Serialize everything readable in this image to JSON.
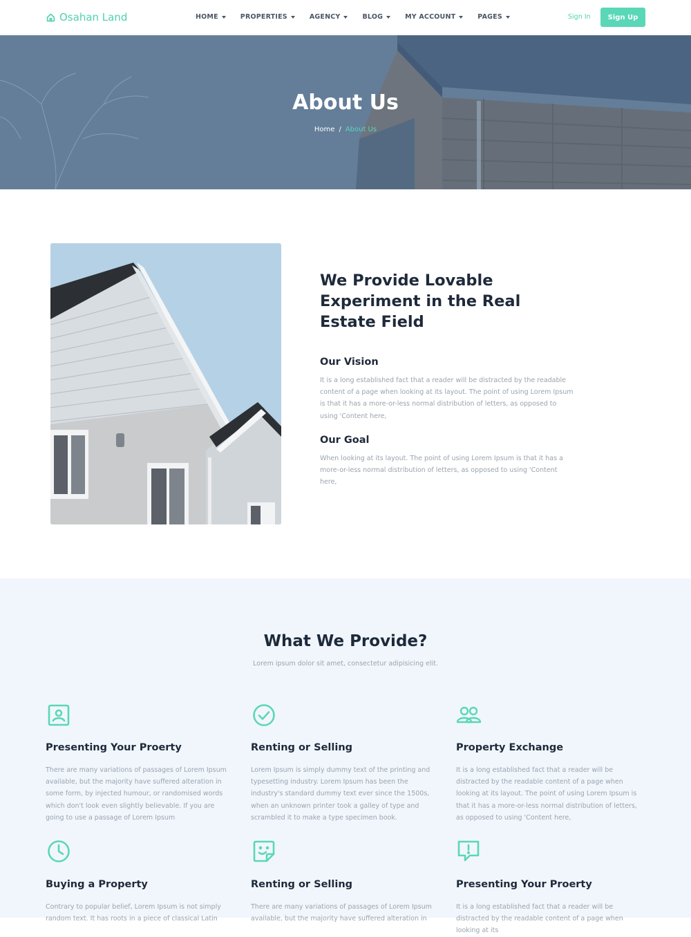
{
  "brand": {
    "name": "Osahan Land",
    "icon": "home-icon"
  },
  "nav": {
    "items": [
      {
        "label": "HOME"
      },
      {
        "label": "PROPERTIES"
      },
      {
        "label": "AGENCY"
      },
      {
        "label": "BLOG"
      },
      {
        "label": "MY ACCOUNT"
      },
      {
        "label": "PAGES"
      }
    ],
    "signin": "Sign In",
    "signup": "Sign Up"
  },
  "hero": {
    "title": "About Us",
    "breadcrumb": {
      "home": "Home",
      "separator": "/",
      "current": "About Us"
    }
  },
  "about": {
    "heading": "We Provide Lovable Experiment in the Real Estate Field",
    "vision": {
      "title": "Our Vision",
      "text": "It is a long established fact that a reader will be distracted by the readable content of a page when looking at its layout. The point of using Lorem Ipsum is that it has a more-or-less normal distribution of letters, as opposed to using 'Content here,"
    },
    "goal": {
      "title": "Our Goal",
      "text": "When looking at its layout. The point of using Lorem Ipsum is that it has a more-or-less normal distribution of letters, as opposed to using 'Content here,"
    }
  },
  "provide": {
    "title": "What We Provide?",
    "subtitle": "Lorem ipsum dolor sit amet, consectetur adipisicing elit.",
    "features": [
      {
        "icon": "portrait-icon",
        "title": "Presenting Your Proerty",
        "text": "There are many variations of passages of Lorem Ipsum available, but the majority have suffered alteration in some form, by injected humour, or randomised words which don't look even slightly believable. If you are going to use a passage of Lorem Ipsum"
      },
      {
        "icon": "check-circle-icon",
        "title": "Renting or Selling",
        "text": "Lorem Ipsum is simply dummy text of the printing and typesetting industry. Lorem Ipsum has been the industry's standard dummy text ever since the 1500s, when an unknown printer took a galley of type and scrambled it to make a type specimen book."
      },
      {
        "icon": "users-icon",
        "title": "Property Exchange",
        "text": "It is a long established fact that a reader will be distracted by the readable content of a page when looking at its layout. The point of using Lorem Ipsum is that it has a more-or-less normal distribution of letters, as opposed to using 'Content here,"
      },
      {
        "icon": "clock-icon",
        "title": "Buying a Property",
        "text": "Contrary to popular belief, Lorem Ipsum is not simply random text. It has roots in a piece of classical Latin"
      },
      {
        "icon": "sticker-smile-icon",
        "title": "Renting or Selling",
        "text": "There are many variations of passages of Lorem Ipsum available, but the majority have suffered alteration in"
      },
      {
        "icon": "message-alert-icon",
        "title": "Presenting Your Proerty",
        "text": "It is a long established fact that a reader will be distracted by the readable content of a page when looking at its"
      }
    ]
  },
  "colors": {
    "accent": "#5ad7b7",
    "heading": "#1e2a3a",
    "muted": "#9aa3ad",
    "section_bg": "#f1f6fd"
  }
}
